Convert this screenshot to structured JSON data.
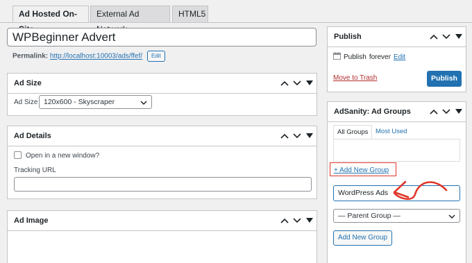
{
  "tabs": [
    {
      "label": "Ad Hosted On-Site"
    },
    {
      "label": "External Ad Network"
    },
    {
      "label": "HTML5"
    }
  ],
  "title_input": {
    "value": "WPBeginner Advert"
  },
  "permalink": {
    "label": "Permalink:",
    "url": "http://localhost:10003/ads/ffef/",
    "edit_label": "Edit"
  },
  "ad_size": {
    "title": "Ad Size",
    "field_label": "Ad Size",
    "selected": "120x600 - Skyscraper"
  },
  "ad_details": {
    "title": "Ad Details",
    "new_window_label": "Open in a new window?",
    "tracking_label": "Tracking URL",
    "tracking_value": ""
  },
  "ad_image": {
    "title": "Ad Image"
  },
  "publish": {
    "title": "Publish",
    "status_text": "Publish",
    "status_value": "forever",
    "edit_label": "Edit",
    "trash_label": "Move to Trash",
    "publish_button": "Publish"
  },
  "ad_groups": {
    "title": "AdSanity: Ad Groups",
    "tab_all": "All Groups",
    "tab_most_used": "Most Used",
    "add_new_link": "+ Add New Group",
    "new_group_value": "WordPress Ads",
    "parent_selected": "— Parent Group —",
    "add_button": "Add New Group"
  },
  "colors": {
    "accent": "#2271b1",
    "annotation_red": "#e0352a",
    "trash_red": "#b32d2e"
  }
}
